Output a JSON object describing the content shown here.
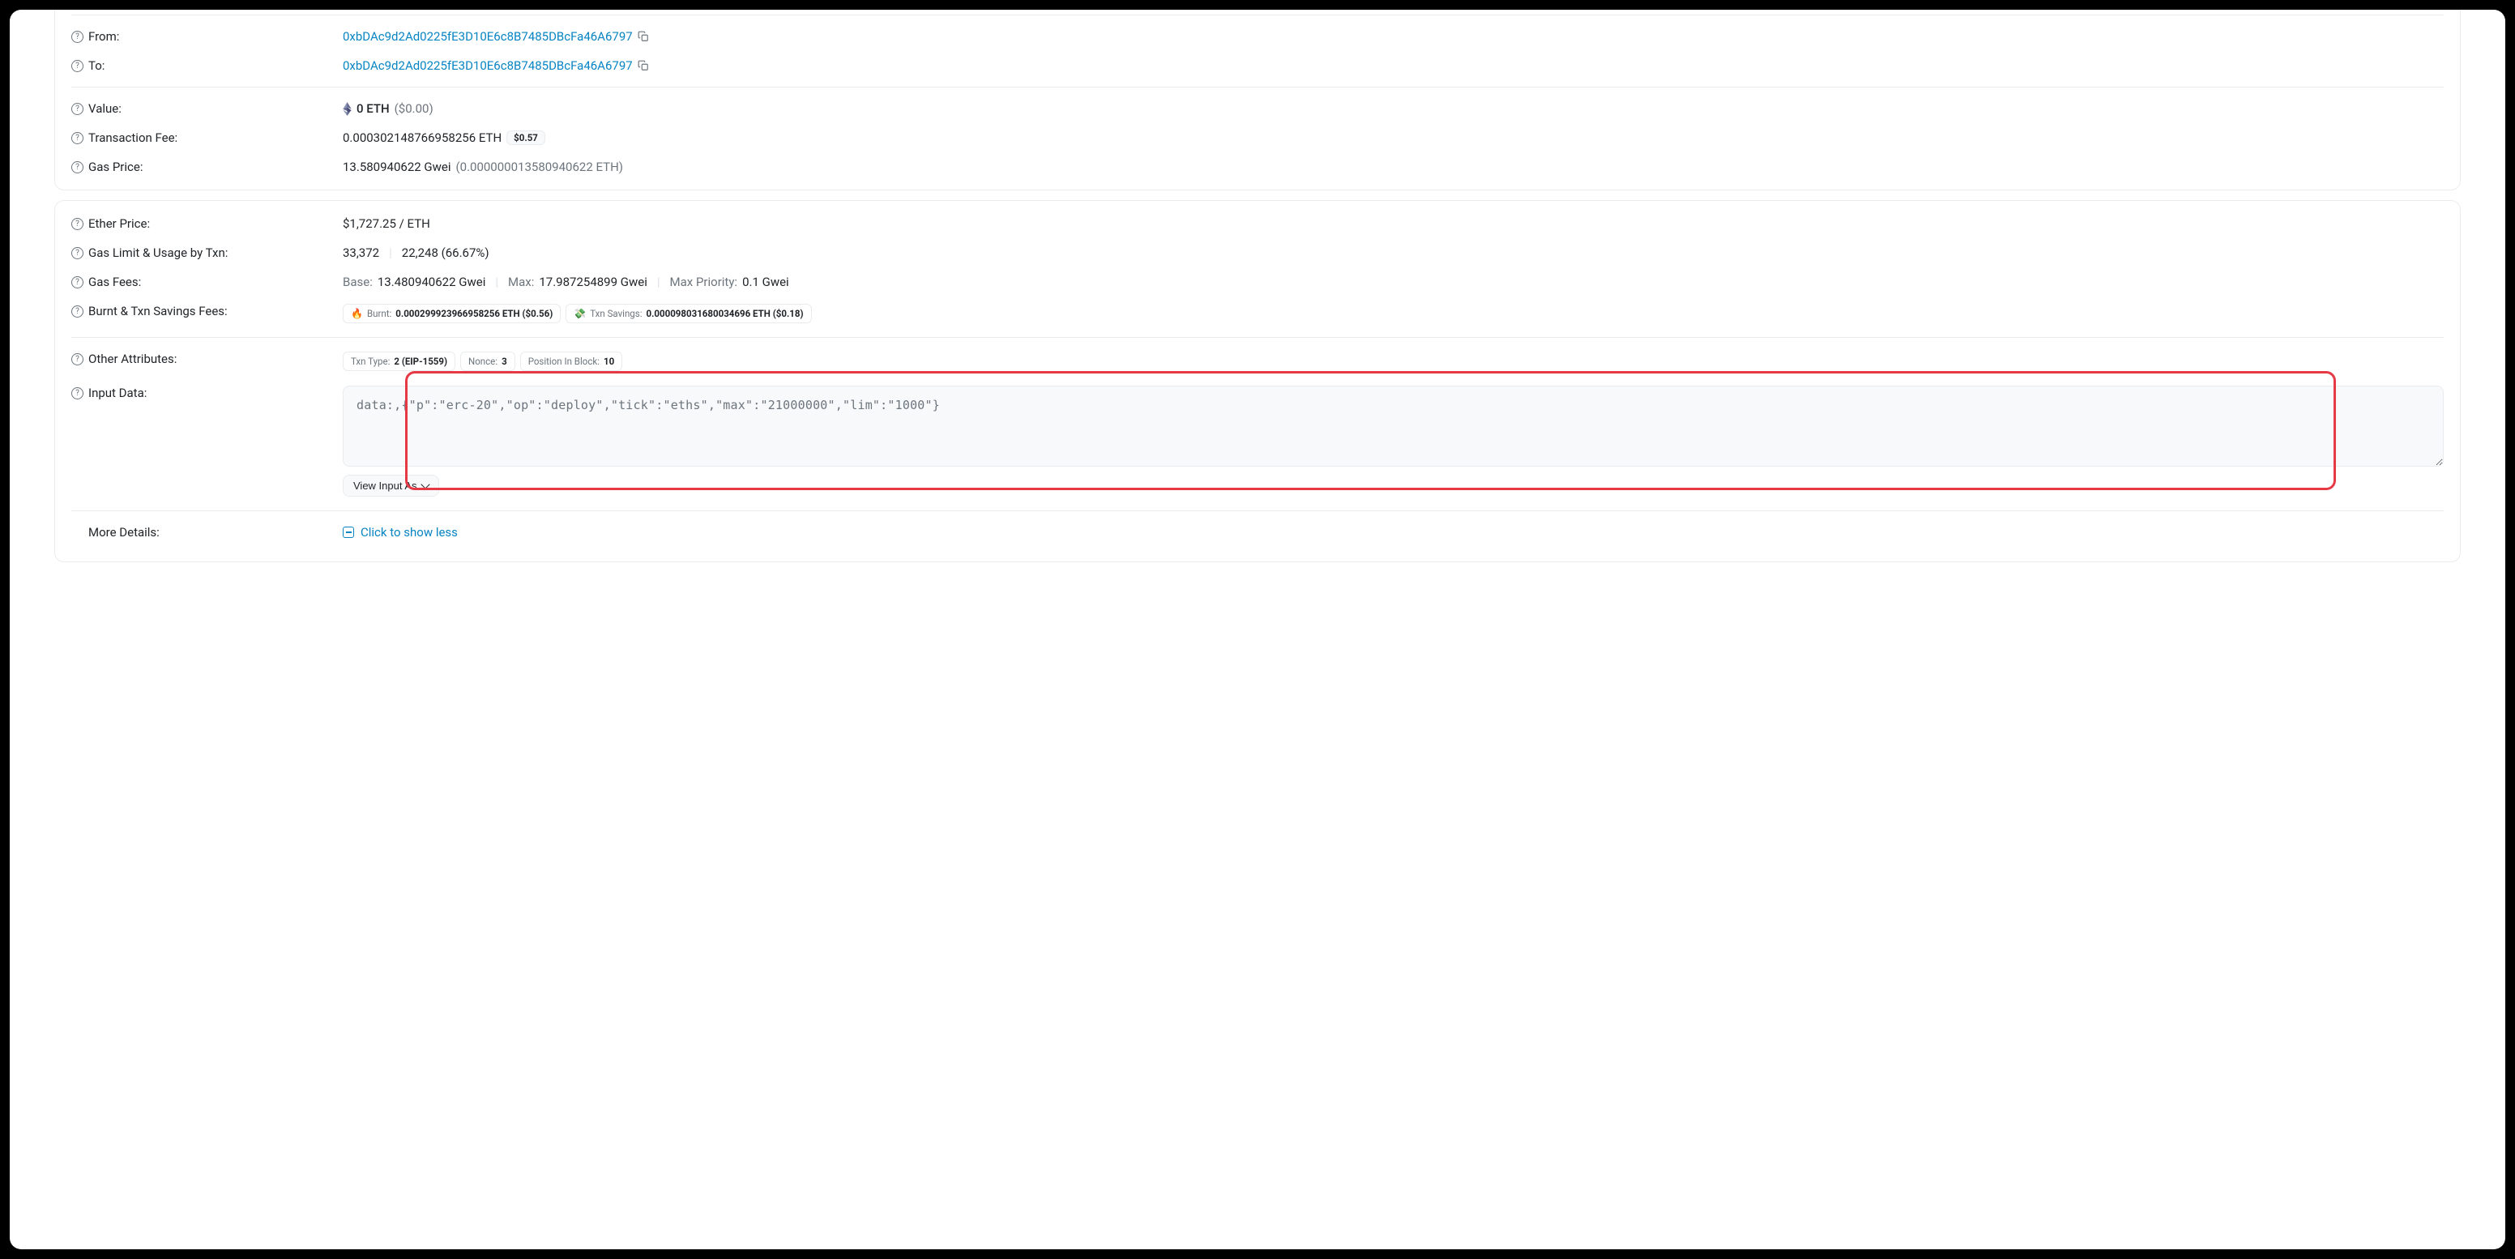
{
  "from": {
    "label": "From:",
    "address": "0xbDAc9d2Ad0225fE3D10E6c8B7485DBcFa46A6797"
  },
  "to": {
    "label": "To:",
    "address": "0xbDAc9d2Ad0225fE3D10E6c8B7485DBcFa46A6797"
  },
  "value": {
    "label": "Value:",
    "amount": "0 ETH",
    "usd": "($0.00)"
  },
  "txn_fee": {
    "label": "Transaction Fee:",
    "amount": "0.000302148766958256 ETH",
    "usd": "$0.57"
  },
  "gas_price": {
    "label": "Gas Price:",
    "amount": "13.580940622 Gwei",
    "eth": "(0.000000013580940622 ETH)"
  },
  "ether_price": {
    "label": "Ether Price:",
    "value": "$1,727.25 / ETH"
  },
  "gas_limit": {
    "label": "Gas Limit & Usage by Txn:",
    "limit": "33,372",
    "usage": "22,248 (66.67%)"
  },
  "gas_fees": {
    "label": "Gas Fees:",
    "base_l": "Base:",
    "base_v": "13.480940622 Gwei",
    "max_l": "Max:",
    "max_v": "17.987254899 Gwei",
    "maxp_l": "Max Priority:",
    "maxp_v": "0.1 Gwei"
  },
  "burnt": {
    "label": "Burnt & Txn Savings Fees:",
    "burnt_l": "Burnt:",
    "burnt_v": "0.000299923966958256 ETH ($0.56)",
    "save_l": "Txn Savings:",
    "save_v": "0.000098031680034696 ETH ($0.18)"
  },
  "other": {
    "label": "Other Attributes:",
    "type_l": "Txn Type:",
    "type_v": "2 (EIP-1559)",
    "nonce_l": "Nonce:",
    "nonce_v": "3",
    "pos_l": "Position In Block:",
    "pos_v": "10"
  },
  "input": {
    "label": "Input Data:",
    "data": "data:,{\"p\":\"erc-20\",\"op\":\"deploy\",\"tick\":\"eths\",\"max\":\"21000000\",\"lim\":\"1000\"}",
    "view_btn": "View Input As"
  },
  "more": {
    "label": "More Details:",
    "text": "Click to show less"
  }
}
